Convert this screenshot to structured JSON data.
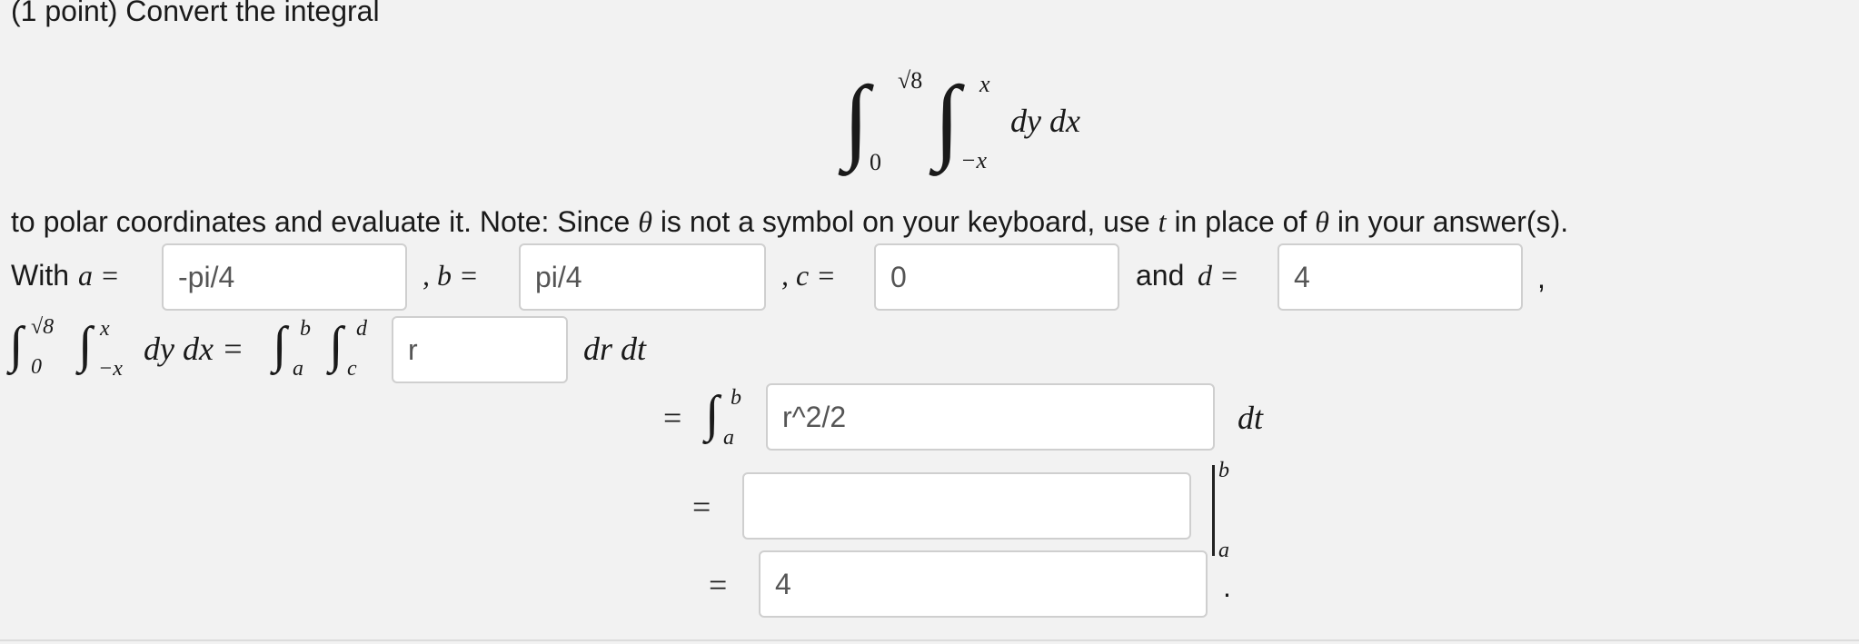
{
  "problem": {
    "header": "(1 point) Convert the integral",
    "display_integral": {
      "outer_upper": "√8",
      "outer_lower": "0",
      "inner_upper": "x",
      "inner_lower": "−x",
      "integrand": "dy dx"
    },
    "instruction_part1": "to polar coordinates and evaluate it. Note: Since ",
    "theta": "θ",
    "instruction_part2": " is not a symbol on your keyboard, use ",
    "t": "t",
    "instruction_part3": " in place of ",
    "instruction_part4": " in your answer(s)."
  },
  "limits_row": {
    "with": "With",
    "a_label": "a =",
    "b_label": ", b =",
    "c_label": ", c =",
    "and": "and",
    "d_label": "d =",
    "trailing_comma": ",",
    "a_value": "-pi/4",
    "b_value": "pi/4",
    "c_value": "0",
    "d_value": "4"
  },
  "equation": {
    "lhs_integrand": "dy dx =",
    "int_upper_b": "b",
    "int_lower_a": "a",
    "int_upper_d": "d",
    "int_lower_c": "c",
    "integrand_value": "r",
    "dr_dt": "dr dt",
    "equals": "=",
    "inner_result_value": "r^2/2",
    "dt": "dt",
    "antiderivative_value": "",
    "eval_upper": "b",
    "eval_lower": "a",
    "final_value": "4",
    "period": "."
  }
}
